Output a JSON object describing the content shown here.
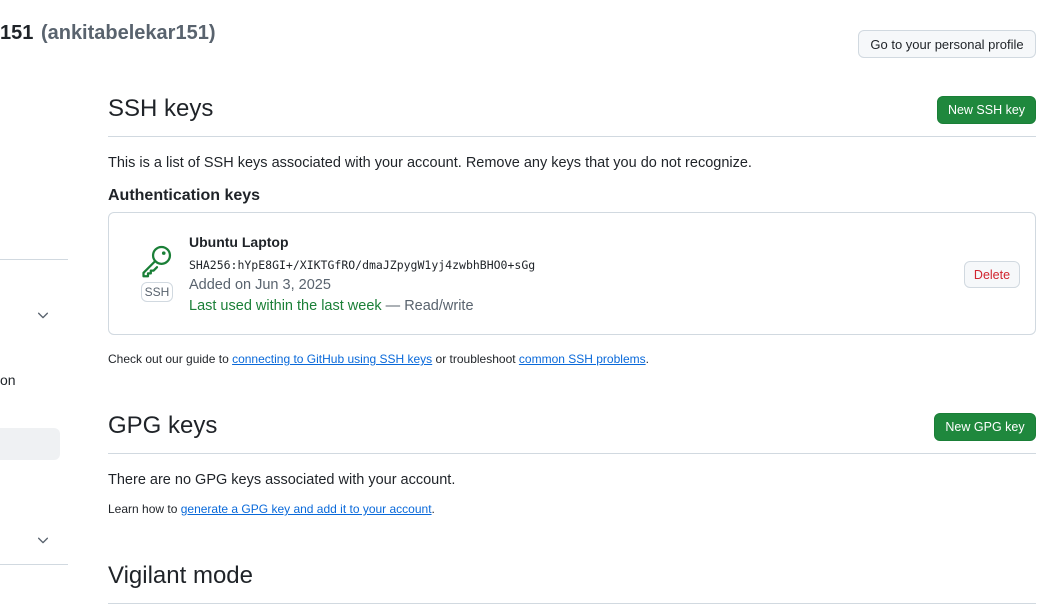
{
  "header": {
    "title_fragment": "151",
    "handle": "(ankitabelekar151)"
  },
  "profile_button_label": "Go to your personal profile",
  "sidebar": {
    "partial_item": "on"
  },
  "ssh": {
    "title": "SSH keys",
    "new_button": "New SSH key",
    "description": "This is a list of SSH keys associated with your account. Remove any keys that you do not recognize.",
    "auth_heading": "Authentication keys",
    "key": {
      "name": "Ubuntu Laptop",
      "fingerprint": "SHA256:hYpE8GI+/XIKTGfRO/dmaJZpygW1yj4zwbhBHO0+sGg",
      "added": "Added on Jun 3, 2025",
      "last_used": "Last used within the last week",
      "access": " — Read/write",
      "badge": "SSH",
      "delete_label": "Delete"
    },
    "guide_prefix": "Check out our guide to ",
    "guide_link": "connecting to GitHub using SSH keys",
    "guide_middle": " or troubleshoot ",
    "guide_link2": "common SSH problems",
    "guide_suffix": "."
  },
  "gpg": {
    "title": "GPG keys",
    "new_button": "New GPG key",
    "empty_text": "There are no GPG keys associated with your account.",
    "learn_prefix": "Learn how to ",
    "learn_link": "generate a GPG key and add it to your account",
    "learn_suffix": "."
  },
  "vigilant": {
    "title": "Vigilant mode"
  },
  "colors": {
    "accent_green": "#1f883d",
    "link_blue": "#0969da",
    "danger_red": "#d1242f",
    "border": "#d1d9e0"
  }
}
